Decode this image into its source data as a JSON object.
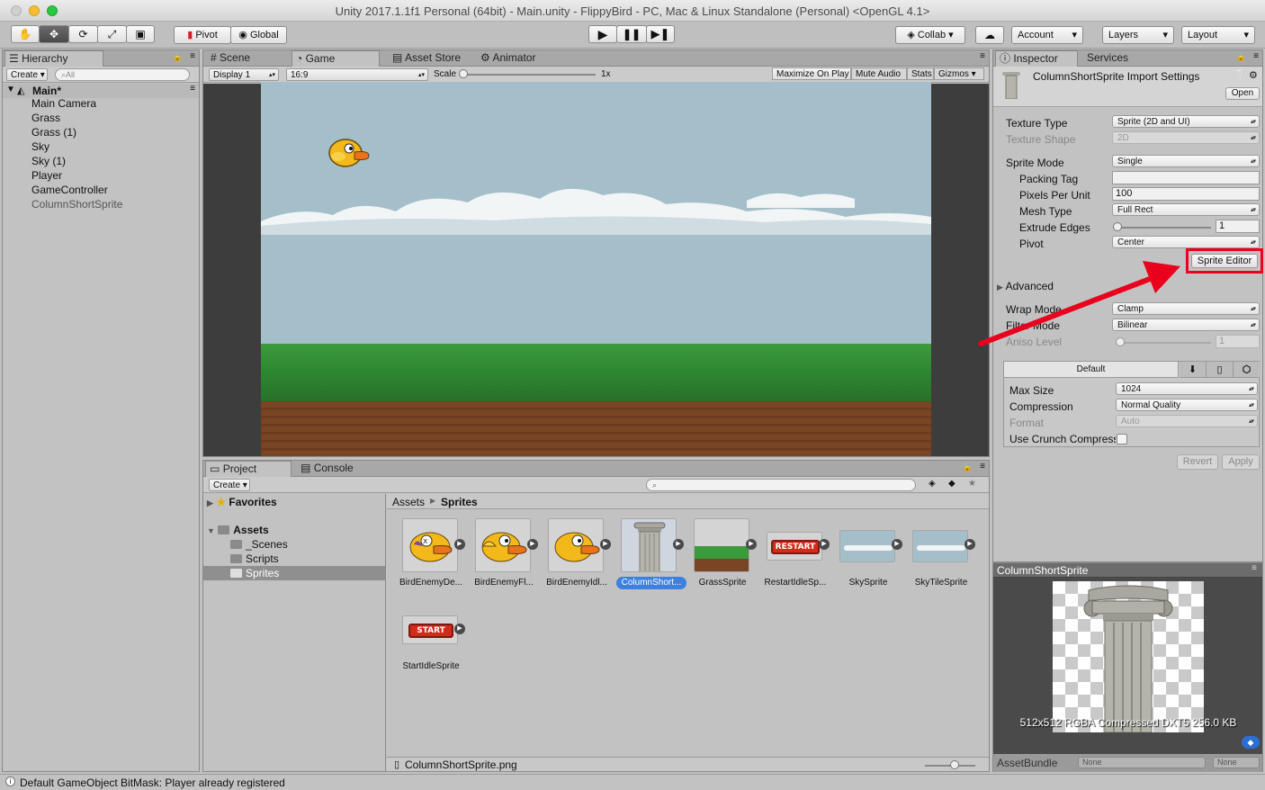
{
  "window": {
    "title": "Unity 2017.1.1f1 Personal (64bit) - Main.unity - FlippyBird - PC, Mac & Linux Standalone (Personal) <OpenGL 4.1>"
  },
  "toolbar": {
    "pivot": "Pivot",
    "global": "Global",
    "collab": "Collab",
    "account": "Account",
    "layers": "Layers",
    "layout": "Layout"
  },
  "hierarchy": {
    "tab": "Hierarchy",
    "create": "Create",
    "search_placeholder": "All",
    "scene": "Main*",
    "items": [
      "Main Camera",
      "Grass",
      "Grass (1)",
      "Sky",
      "Sky (1)",
      "Player",
      "GameController",
      "ColumnShortSprite"
    ]
  },
  "game_view": {
    "tabs": [
      "Scene",
      "Game",
      "Asset Store",
      "Animator"
    ],
    "display": "Display 1",
    "aspect": "16:9",
    "scale_label": "Scale",
    "scale_value": "1x",
    "maximize": "Maximize On Play",
    "mute": "Mute Audio",
    "stats": "Stats",
    "gizmos": "Gizmos"
  },
  "project": {
    "tabs": [
      "Project",
      "Console"
    ],
    "create": "Create",
    "tree": {
      "favorites": "Favorites",
      "assets": "Assets",
      "folders": [
        "_Scenes",
        "Scripts",
        "Sprites"
      ]
    },
    "breadcrumb": [
      "Assets",
      "Sprites"
    ],
    "assets": [
      "BirdEnemyDe...",
      "BirdEnemyFl...",
      "BirdEnemyIdl...",
      "ColumnShort...",
      "GrassSprite",
      "RestartIdleSp...",
      "SkySprite",
      "SkyTileSprite",
      "StartIdleSprite"
    ],
    "restart_label": "RESTART",
    "start_label": "START",
    "footer_file": "ColumnShortSprite.png"
  },
  "inspector": {
    "tabs": [
      "Inspector",
      "Services"
    ],
    "header_title": "ColumnShortSprite Import Settings",
    "open": "Open",
    "rows": [
      {
        "label": "Texture Type",
        "value": "Sprite (2D and UI)"
      },
      {
        "label": "Texture Shape",
        "value": "2D"
      },
      {
        "label": "Sprite Mode",
        "value": "Single"
      },
      {
        "label": "Packing Tag",
        "value": ""
      },
      {
        "label": "Pixels Per Unit",
        "value": "100"
      },
      {
        "label": "Mesh Type",
        "value": "Full Rect"
      },
      {
        "label": "Extrude Edges",
        "value": "1"
      },
      {
        "label": "Pivot",
        "value": "Center"
      }
    ],
    "sprite_editor": "Sprite Editor",
    "advanced": "Advanced",
    "wrap_mode": {
      "label": "Wrap Mode",
      "value": "Clamp"
    },
    "filter_mode": {
      "label": "Filter Mode",
      "value": "Bilinear"
    },
    "aniso": {
      "label": "Aniso Level",
      "value": "1"
    },
    "platform": {
      "tab": "Default",
      "max_size": {
        "label": "Max Size",
        "value": "1024"
      },
      "compression": {
        "label": "Compression",
        "value": "Normal Quality"
      },
      "format": {
        "label": "Format",
        "value": "Auto"
      },
      "crunch": {
        "label": "Use Crunch Compression",
        "checked": false
      }
    },
    "revert": "Revert",
    "apply": "Apply",
    "preview": {
      "title": "ColumnShortSprite",
      "info": "512x512  RGBA Compressed DXT5  256.0 KB"
    },
    "assetbundle": {
      "label": "AssetBundle",
      "value": "None",
      "variant": "None"
    }
  },
  "status_bar": "Default GameObject BitMask: Player already registered",
  "colors": {
    "highlight_red": "#e8001c",
    "selection_blue": "#3d80df",
    "sky": "#a4bfc9",
    "grass": "#3a9a3c",
    "dirt": "#7a4524"
  }
}
